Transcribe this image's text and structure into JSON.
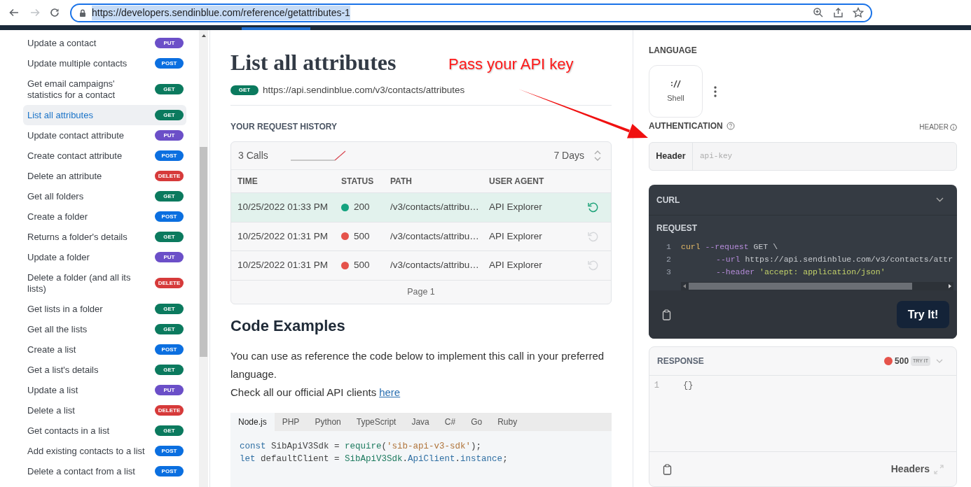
{
  "browser": {
    "url": "https://developers.sendinblue.com/reference/getattributes-1"
  },
  "sidebar": {
    "items": [
      {
        "label": "Update a contact",
        "method": "PUT",
        "color": "#6b4fc8",
        "selected": false
      },
      {
        "label": "Update multiple contacts",
        "method": "POST",
        "color": "#0b6fe0",
        "selected": false
      },
      {
        "label": "Get email campaigns' statistics for a contact",
        "method": "GET",
        "color": "#0b7a5e",
        "selected": false
      },
      {
        "label": "List all attributes",
        "method": "GET",
        "color": "#0b7a5e",
        "selected": true
      },
      {
        "label": "Update contact attribute",
        "method": "PUT",
        "color": "#6b4fc8",
        "selected": false
      },
      {
        "label": "Create contact attribute",
        "method": "POST",
        "color": "#0b6fe0",
        "selected": false
      },
      {
        "label": "Delete an attribute",
        "method": "DELETE",
        "color": "#d63a3a",
        "selected": false
      },
      {
        "label": "Get all folders",
        "method": "GET",
        "color": "#0b7a5e",
        "selected": false
      },
      {
        "label": "Create a folder",
        "method": "POST",
        "color": "#0b6fe0",
        "selected": false
      },
      {
        "label": "Returns a folder's details",
        "method": "GET",
        "color": "#0b7a5e",
        "selected": false
      },
      {
        "label": "Update a folder",
        "method": "PUT",
        "color": "#6b4fc8",
        "selected": false
      },
      {
        "label": "Delete a folder (and all its lists)",
        "method": "DELETE",
        "color": "#d63a3a",
        "selected": false
      },
      {
        "label": "Get lists in a folder",
        "method": "GET",
        "color": "#0b7a5e",
        "selected": false
      },
      {
        "label": "Get all the lists",
        "method": "GET",
        "color": "#0b7a5e",
        "selected": false
      },
      {
        "label": "Create a list",
        "method": "POST",
        "color": "#0b6fe0",
        "selected": false
      },
      {
        "label": "Get a list's details",
        "method": "GET",
        "color": "#0b7a5e",
        "selected": false
      },
      {
        "label": "Update a list",
        "method": "PUT",
        "color": "#6b4fc8",
        "selected": false
      },
      {
        "label": "Delete a list",
        "method": "DELETE",
        "color": "#d63a3a",
        "selected": false
      },
      {
        "label": "Get contacts in a list",
        "method": "GET",
        "color": "#0b7a5e",
        "selected": false
      },
      {
        "label": "Add existing contacts to a list",
        "method": "POST",
        "color": "#0b6fe0",
        "selected": false
      },
      {
        "label": "Delete a contact from a list",
        "method": "POST",
        "color": "#0b6fe0",
        "selected": false
      }
    ]
  },
  "endpoint": {
    "title": "List all attributes",
    "method": "GET",
    "url": "https://api.sendinblue.com/v3/contacts/attributes"
  },
  "history": {
    "heading": "YOUR REQUEST HISTORY",
    "calls": "3 Calls",
    "period": "7 Days",
    "columns": [
      "TIME",
      "STATUS",
      "PATH",
      "USER AGENT"
    ],
    "rows": [
      {
        "time": "10/25/2022 01:33 PM",
        "status": "200",
        "color": "#14a37f",
        "path": "/v3/contacts/attribu…",
        "agent": "API Explorer",
        "selected": true
      },
      {
        "time": "10/25/2022 01:31 PM",
        "status": "500",
        "color": "#e5534b",
        "path": "/v3/contacts/attribu…",
        "agent": "API Explorer",
        "selected": false
      },
      {
        "time": "10/25/2022 01:31 PM",
        "status": "500",
        "color": "#e5534b",
        "path": "/v3/contacts/attribu…",
        "agent": "API Explorer",
        "selected": false
      }
    ],
    "page": "Page 1"
  },
  "code_examples": {
    "heading": "Code Examples",
    "intro": "You can use as reference the code below to implement this call in your preferred language.",
    "check": "Check all our official API clients",
    "link": "here",
    "tabs": [
      {
        "label": "Node.js",
        "selected": true
      },
      {
        "label": "PHP",
        "selected": false
      },
      {
        "label": "Python",
        "selected": false
      },
      {
        "label": "TypeScript",
        "selected": false
      },
      {
        "label": "Java",
        "selected": false
      },
      {
        "label": "C#",
        "selected": false
      },
      {
        "label": "Go",
        "selected": false
      },
      {
        "label": "Ruby",
        "selected": false
      }
    ],
    "lines": [
      [
        {
          "text": "const",
          "kind": "keyword"
        },
        {
          "text": " SibApiV3Sdk = ",
          "kind": "plain"
        },
        {
          "text": "require",
          "kind": "func"
        },
        {
          "text": "(",
          "kind": "plain"
        },
        {
          "text": "'sib-api-v3-sdk'",
          "kind": "string"
        },
        {
          "text": ");",
          "kind": "plain"
        }
      ],
      [
        {
          "text": "let",
          "kind": "keyword"
        },
        {
          "text": " defaultClient = ",
          "kind": "plain"
        },
        {
          "text": "SibApiV3Sdk",
          "kind": "func"
        },
        {
          "text": ".",
          "kind": "plain"
        },
        {
          "text": "ApiClient",
          "kind": "keyword"
        },
        {
          "text": ".",
          "kind": "plain"
        },
        {
          "text": "instance",
          "kind": "keyword"
        },
        {
          "text": ";",
          "kind": "plain"
        }
      ]
    ]
  },
  "language": {
    "heading": "LANGUAGE",
    "option": "Shell"
  },
  "auth": {
    "heading": "AUTHENTICATION",
    "type": "HEADER",
    "label": "Header",
    "placeholder": "api-key"
  },
  "request": {
    "title": "CURL",
    "subheading": "REQUEST",
    "button": "Try It!",
    "lines": [
      {
        "number": "1",
        "indented": false,
        "tokens": [
          {
            "text": "curl",
            "kind": "command"
          },
          {
            "text": " --request",
            "kind": "flag"
          },
          {
            "text": " GET \\",
            "kind": "plain"
          }
        ]
      },
      {
        "number": "2",
        "indented": true,
        "tokens": [
          {
            "text": "--url",
            "kind": "flag"
          },
          {
            "text": " https://api.sendinblue.com/v3/contacts/attr",
            "kind": "plain"
          }
        ]
      },
      {
        "number": "3",
        "indented": true,
        "tokens": [
          {
            "text": "--header",
            "kind": "flag"
          },
          {
            "text": " 'accept: application/json'",
            "kind": "string"
          }
        ]
      }
    ]
  },
  "response": {
    "heading": "RESPONSE",
    "status": "500",
    "color": "#e5534b",
    "badge": "TRY IT",
    "lines": [
      {
        "number": "1",
        "text": "{}"
      }
    ],
    "headers": "Headers"
  },
  "annotation": {
    "text": "Pass your API key"
  }
}
